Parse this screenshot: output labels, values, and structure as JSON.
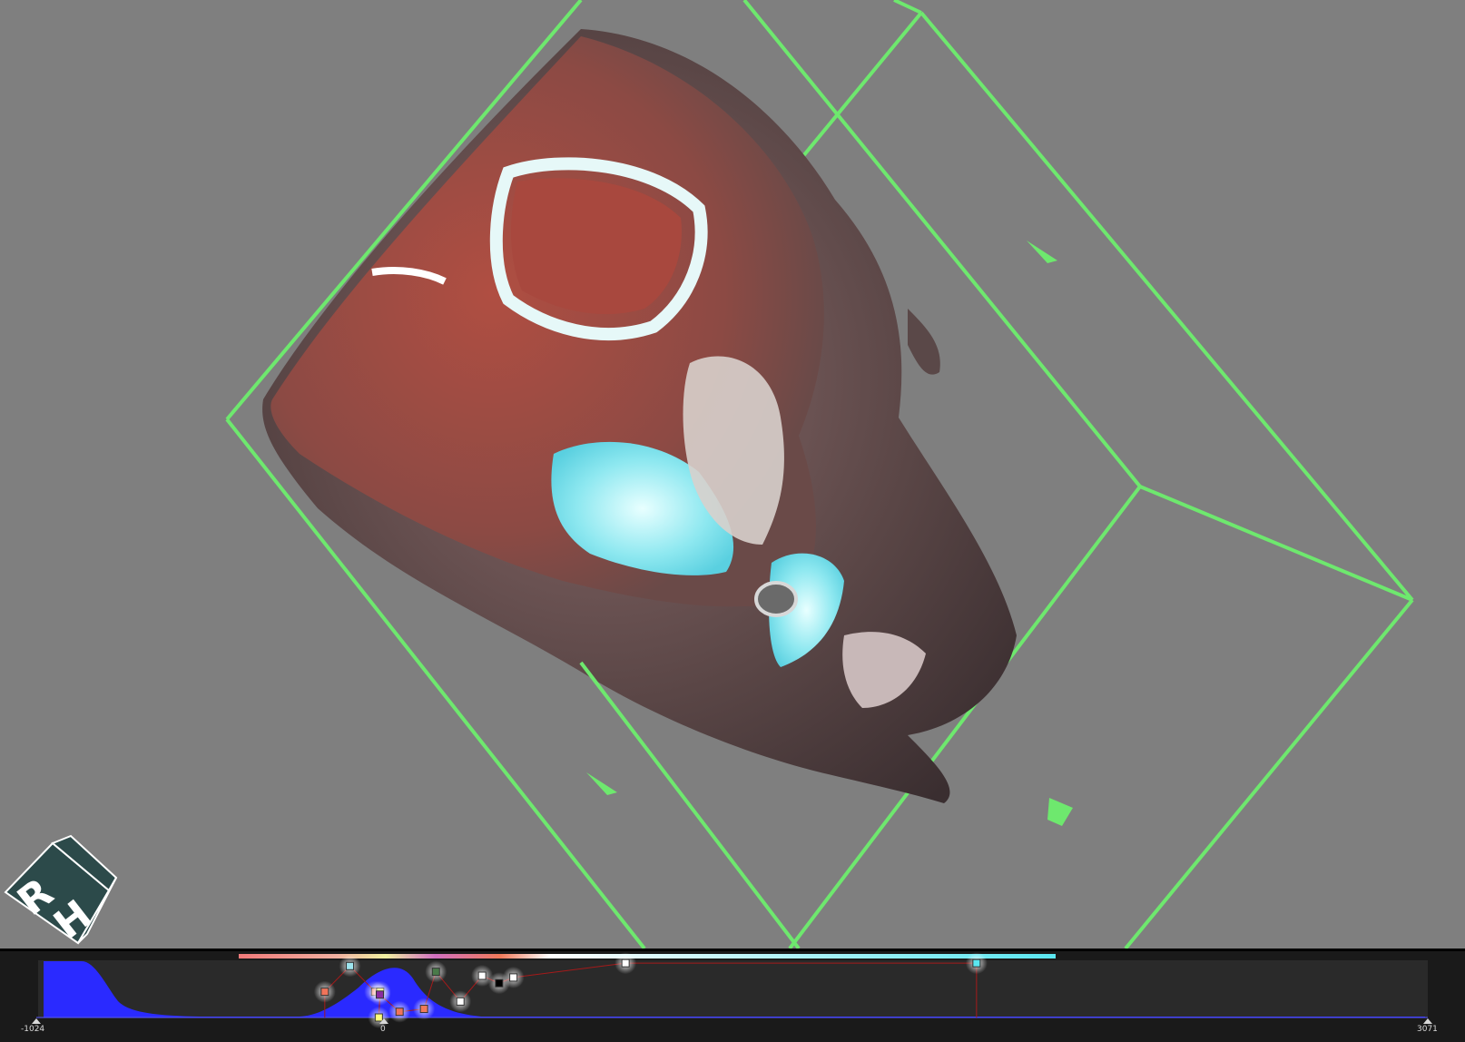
{
  "viewport": {
    "background": "#7f7f7f",
    "box_color": "#6ee86e",
    "orientation_cube": {
      "faces": [
        "R",
        "H"
      ],
      "face_color": "#2c4a4a",
      "letter_color": "#ffffff"
    }
  },
  "transfer_function": {
    "range_min_label": "-1024",
    "range_zero_label": "0",
    "range_max_label": "3071",
    "range": [
      -1024,
      3071
    ],
    "histogram_color": "#2a2aff",
    "line_color": "#a51a1a",
    "control_points": [
      {
        "hu": -175,
        "opacity": 0.45,
        "color": "#f0745a"
      },
      {
        "hu": -101,
        "opacity": 0.9,
        "color": "#9ee6f0"
      },
      {
        "hu": -27,
        "opacity": 0.45,
        "color": "#f08c7a"
      },
      {
        "hu": -12,
        "opacity": 0.45,
        "color": "#f0f05a"
      },
      {
        "hu": -16,
        "opacity": 0.0,
        "color": "#ffff7a"
      },
      {
        "hu": -13,
        "opacity": 0.4,
        "color": "#8a2aa0"
      },
      {
        "hu": 45,
        "opacity": 0.1,
        "color": "#f0745a"
      },
      {
        "hu": 117,
        "opacity": 0.15,
        "color": "#f07a5a"
      },
      {
        "hu": 152,
        "opacity": 0.8,
        "color": "#4a7a4a"
      },
      {
        "hu": 224,
        "opacity": 0.28,
        "color": "#ffffff"
      },
      {
        "hu": 288,
        "opacity": 0.73,
        "color": "#ffffff"
      },
      {
        "hu": 338,
        "opacity": 0.6,
        "color": "#000000"
      },
      {
        "hu": 380,
        "opacity": 0.7,
        "color": "#ffffff"
      },
      {
        "hu": 710,
        "opacity": 0.95,
        "color": "#ffffff"
      },
      {
        "hu": 1743,
        "opacity": 0.95,
        "color": "#5ae6f0"
      }
    ]
  }
}
